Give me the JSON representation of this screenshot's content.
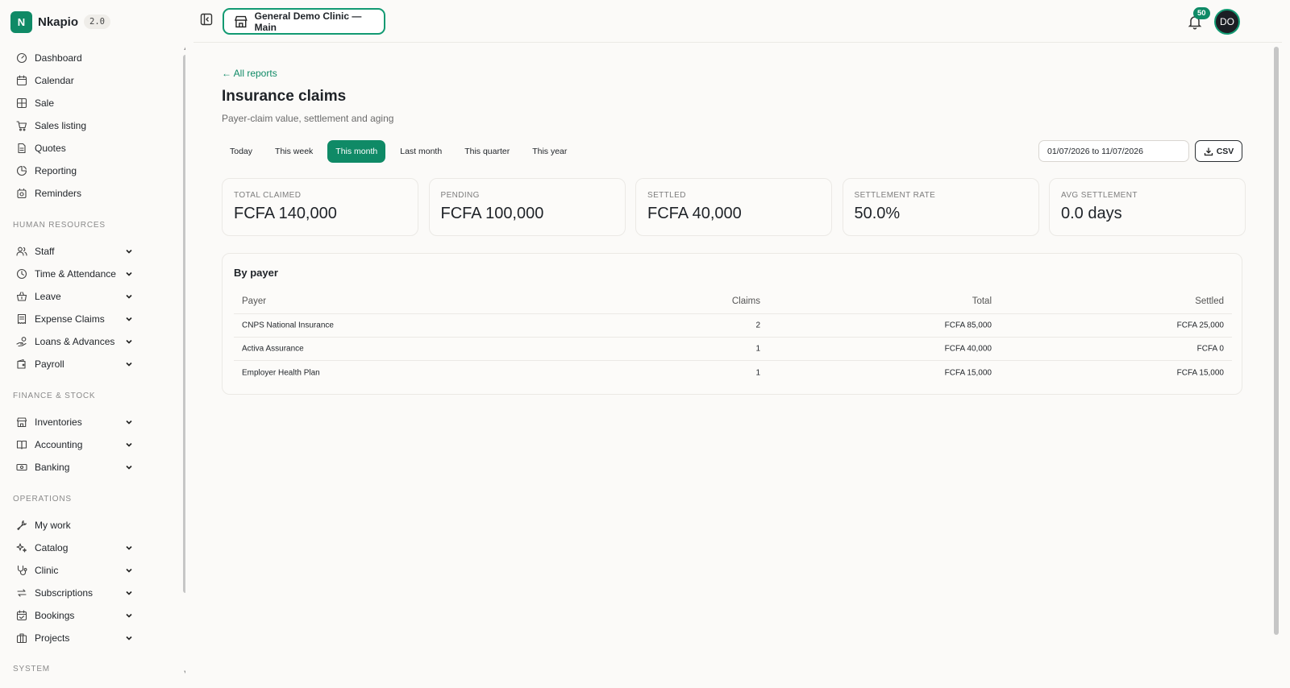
{
  "brand": {
    "logo_letter": "N",
    "name": "Nkapio",
    "version": "2.0"
  },
  "sidebar": {
    "top_items": [
      {
        "label": "Dashboard",
        "icon": "dashboard-icon"
      },
      {
        "label": "Calendar",
        "icon": "calendar-icon"
      },
      {
        "label": "Sale",
        "icon": "grid-icon"
      },
      {
        "label": "Sales listing",
        "icon": "cart-icon"
      },
      {
        "label": "Quotes",
        "icon": "document-icon"
      },
      {
        "label": "Reporting",
        "icon": "pie-chart-icon"
      },
      {
        "label": "Reminders",
        "icon": "alarm-icon"
      }
    ],
    "sections": [
      {
        "title": "HUMAN RESOURCES",
        "items": [
          {
            "label": "Staff",
            "icon": "users-icon"
          },
          {
            "label": "Time & Attendance",
            "icon": "clock-icon"
          },
          {
            "label": "Leave",
            "icon": "basket-icon"
          },
          {
            "label": "Expense Claims",
            "icon": "receipt-icon"
          },
          {
            "label": "Loans & Advances",
            "icon": "hand-coins-icon"
          },
          {
            "label": "Payroll",
            "icon": "wallet-icon"
          }
        ]
      },
      {
        "title": "FINANCE & STOCK",
        "items": [
          {
            "label": "Inventories",
            "icon": "store-icon"
          },
          {
            "label": "Accounting",
            "icon": "book-icon"
          },
          {
            "label": "Banking",
            "icon": "banknote-icon"
          }
        ]
      },
      {
        "title": "OPERATIONS",
        "items": [
          {
            "label": "My work",
            "icon": "wrench-icon"
          },
          {
            "label": "Catalog",
            "icon": "sparkles-icon"
          },
          {
            "label": "Clinic",
            "icon": "stethoscope-icon"
          },
          {
            "label": "Subscriptions",
            "icon": "repeat-icon"
          },
          {
            "label": "Bookings",
            "icon": "calendar-check-icon"
          },
          {
            "label": "Projects",
            "icon": "briefcase-icon"
          }
        ]
      },
      {
        "title": "SYSTEM",
        "items": []
      }
    ]
  },
  "topbar": {
    "clinic_label": "General Demo Clinic — Main",
    "notification_count": "50",
    "avatar_initials": "DO"
  },
  "page": {
    "back_link": "← All reports",
    "title": "Insurance claims",
    "subtitle": "Payer-claim value, settlement and aging"
  },
  "period_tabs": [
    {
      "label": "Today",
      "active": false
    },
    {
      "label": "This week",
      "active": false
    },
    {
      "label": "This month",
      "active": true
    },
    {
      "label": "Last month",
      "active": false
    },
    {
      "label": "This quarter",
      "active": false
    },
    {
      "label": "This year",
      "active": false
    }
  ],
  "date_range": "01/07/2026 to 11/07/2026",
  "csv_label": "CSV",
  "stats": [
    {
      "label": "TOTAL CLAIMED",
      "value": "FCFA 140,000"
    },
    {
      "label": "PENDING",
      "value": "FCFA 100,000"
    },
    {
      "label": "SETTLED",
      "value": "FCFA 40,000"
    },
    {
      "label": "SETTLEMENT RATE",
      "value": "50.0%"
    },
    {
      "label": "AVG SETTLEMENT",
      "value": "0.0 days"
    }
  ],
  "by_payer": {
    "title": "By payer",
    "columns": [
      "Payer",
      "Claims",
      "Total",
      "Settled"
    ],
    "rows": [
      {
        "payer": "CNPS National Insurance",
        "claims": "2",
        "total": "FCFA 85,000",
        "settled": "FCFA 25,000"
      },
      {
        "payer": "Activa Assurance",
        "claims": "1",
        "total": "FCFA 40,000",
        "settled": "FCFA 0"
      },
      {
        "payer": "Employer Health Plan",
        "claims": "1",
        "total": "FCFA 15,000",
        "settled": "FCFA 15,000"
      }
    ]
  },
  "colors": {
    "accent": "#0f8a66",
    "background": "#fbfaf8",
    "border": "#ebe9e5"
  }
}
